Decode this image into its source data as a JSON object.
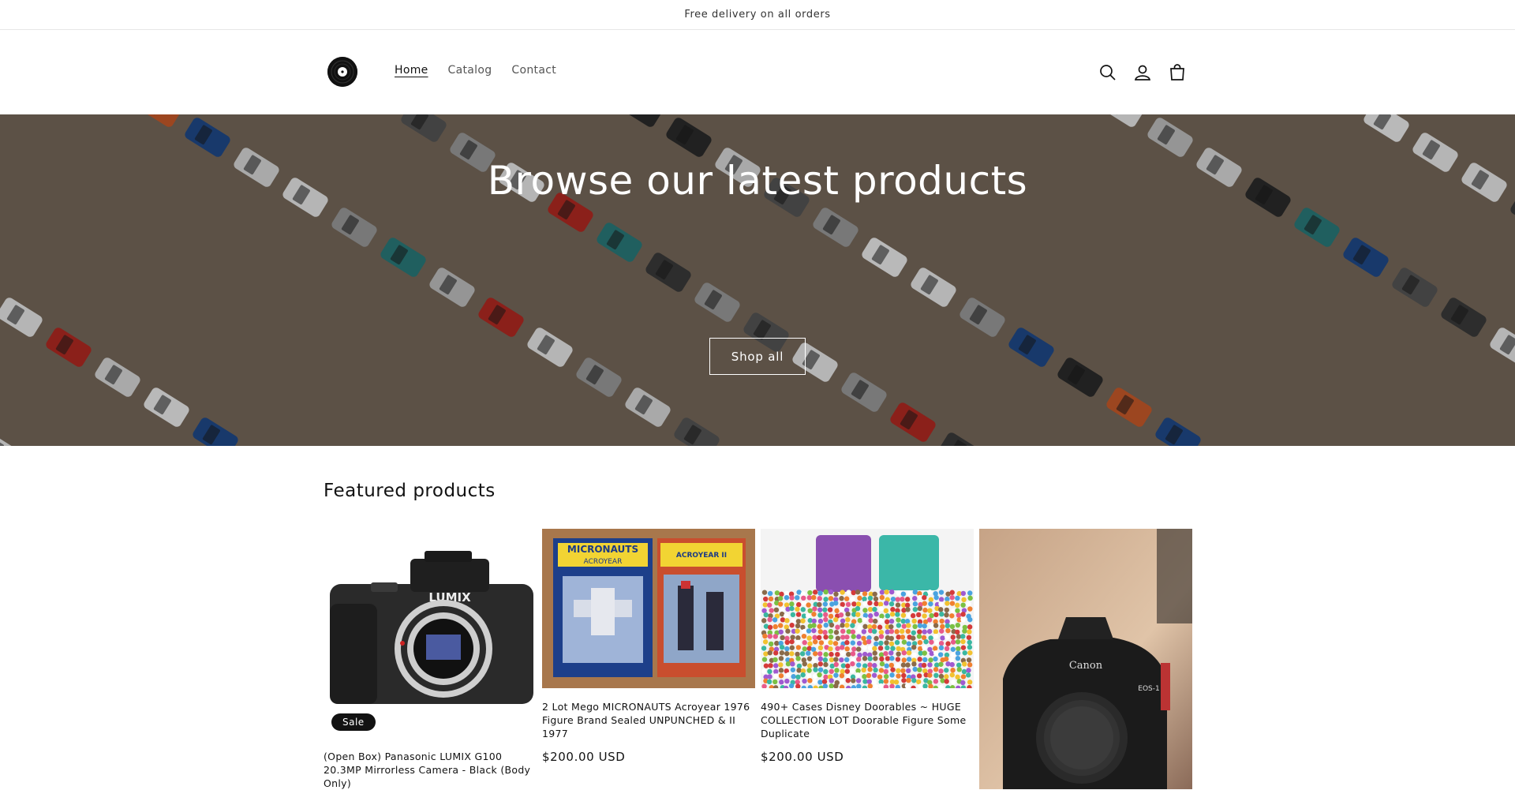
{
  "announcement": {
    "text": "Free delivery on all orders"
  },
  "header": {
    "logo": "vinyl-record-logo",
    "nav": [
      {
        "label": "Home",
        "active": true
      },
      {
        "label": "Catalog",
        "active": false
      },
      {
        "label": "Contact",
        "active": false
      }
    ],
    "icons": [
      "search-icon",
      "account-icon",
      "cart-icon"
    ]
  },
  "hero": {
    "title": "Browse our latest products",
    "button": "Shop all"
  },
  "featured": {
    "title": "Featured products",
    "products": [
      {
        "title": "(Open Box) Panasonic LUMIX G100 20.3MP Mirrorless Camera - Black (Body Only)",
        "price": "",
        "badge": "Sale",
        "image": "camera-lumix"
      },
      {
        "title": "2 Lot Mego MICRONAUTS Acroyear 1976 Figure Brand Sealed UNPUNCHED & II 1977",
        "price": "$200.00 USD",
        "badge": "",
        "image": "micronauts-figures",
        "image_text": [
          "MICRONAUTS",
          "ACROYEAR",
          "ACROYEAR II"
        ]
      },
      {
        "title": "490+ Cases Disney Doorables ~ HUGE COLLECTION LOT Doorable Figure Some Duplicate",
        "price": "$200.00 USD",
        "badge": "",
        "image": "doorables-collection"
      },
      {
        "title": "",
        "price": "",
        "badge": "",
        "image": "camera-canon",
        "image_text": [
          "Canon",
          "EOS-1"
        ]
      }
    ]
  },
  "colors": {
    "text": "#121212",
    "border": "#e6e6e6",
    "badge": "#121212"
  }
}
